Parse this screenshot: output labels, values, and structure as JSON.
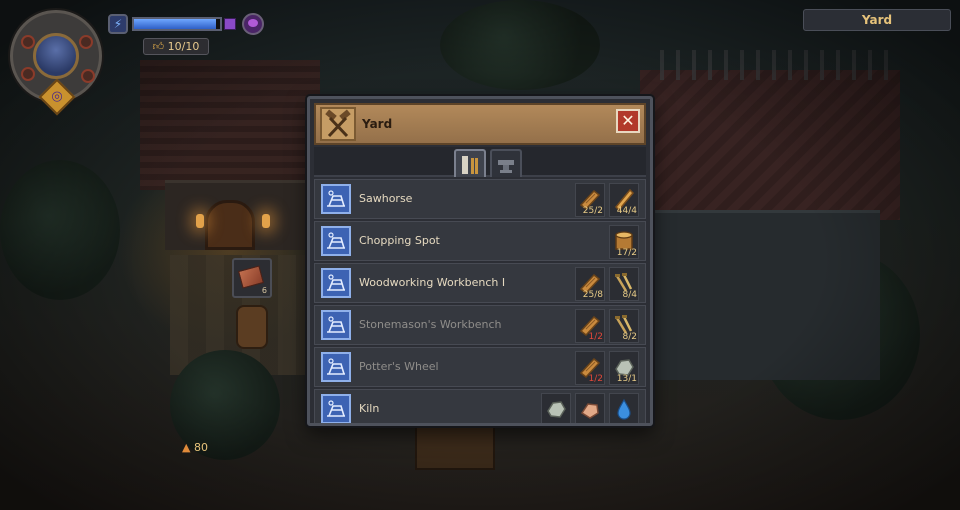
{
  "hud": {
    "energy_fraction": 0.95,
    "approval": "10/10",
    "approval_icon": "thumbs-up-icon",
    "location_label": "Yard",
    "side_slot_count": "6",
    "light_count": "80"
  },
  "panel": {
    "title": "Yard",
    "tabs": [
      {
        "name": "woodworking-tab",
        "icon": "saw-icon",
        "active": true
      },
      {
        "name": "smithing-tab",
        "icon": "anvil-icon",
        "active": false
      }
    ],
    "items": [
      {
        "label": "Sawhorse",
        "dim": false,
        "icon": "sawhorse-blueprint-icon",
        "reqs": [
          {
            "icon": "plank-icon",
            "count": "25/2",
            "short": false
          },
          {
            "icon": "wooden-beam-icon",
            "count": "44/4",
            "short": false
          }
        ]
      },
      {
        "label": "Chopping Spot",
        "dim": false,
        "icon": "axe-blueprint-icon",
        "reqs": [
          {
            "icon": "log-icon",
            "count": "17/2",
            "short": false
          }
        ]
      },
      {
        "label": "Woodworking Workbench I",
        "dim": false,
        "icon": "workbench-blueprint-icon",
        "reqs": [
          {
            "icon": "plank-icon",
            "count": "25/8",
            "short": false
          },
          {
            "icon": "nails-icon",
            "count": "8/4",
            "short": false
          }
        ]
      },
      {
        "label": "Stonemason's Workbench",
        "dim": true,
        "icon": "stonemason-blueprint-icon",
        "reqs": [
          {
            "icon": "plank-icon",
            "count": "1/2",
            "short": true
          },
          {
            "icon": "nails-icon",
            "count": "8/2",
            "short": false
          }
        ]
      },
      {
        "label": "Potter's Wheel",
        "dim": true,
        "icon": "potters-wheel-blueprint-icon",
        "reqs": [
          {
            "icon": "plank-icon",
            "count": "1/2",
            "short": true
          },
          {
            "icon": "stone-icon",
            "count": "13/1",
            "short": false
          }
        ]
      },
      {
        "label": "Kiln",
        "dim": false,
        "icon": "kiln-blueprint-icon",
        "reqs": [
          {
            "icon": "stone-icon",
            "count": "",
            "short": false
          },
          {
            "icon": "clay-icon",
            "count": "",
            "short": false
          },
          {
            "icon": "water-icon",
            "count": "",
            "short": false
          }
        ]
      }
    ]
  },
  "colors": {
    "accent_gold": "#e6c27a",
    "shortage_red": "#e0483a",
    "blueprint_blue": "#3d63b3"
  }
}
